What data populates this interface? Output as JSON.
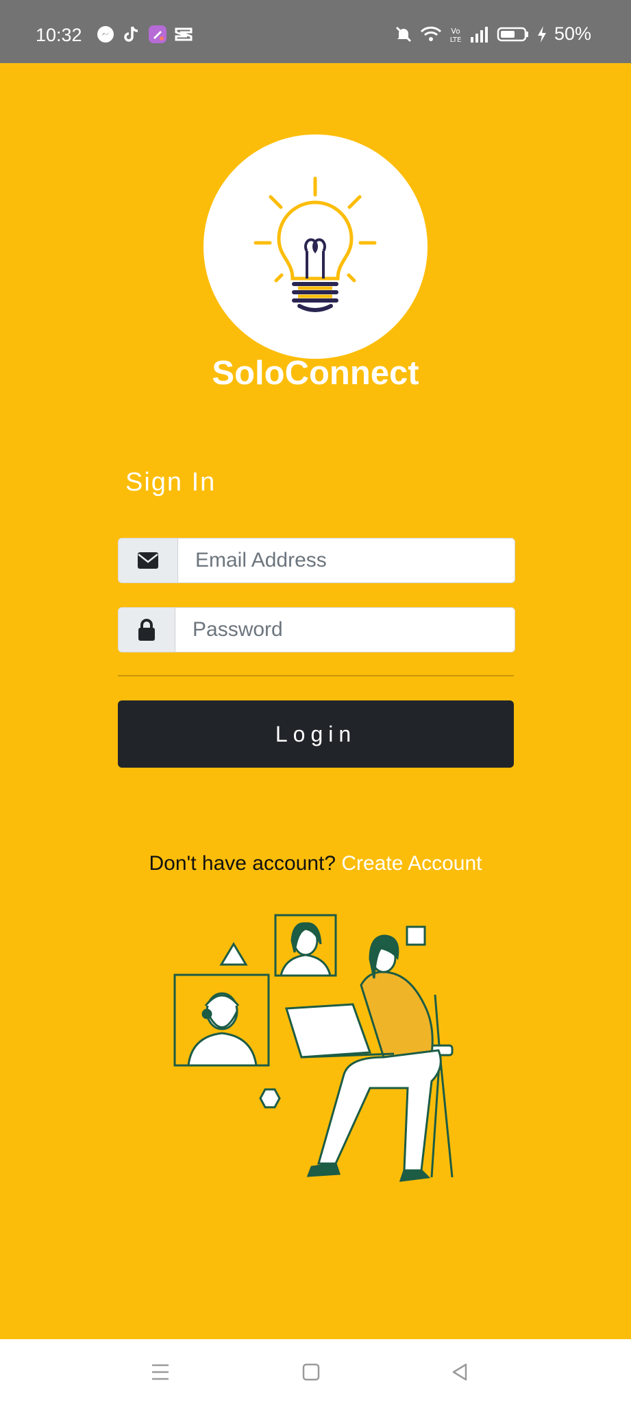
{
  "status_bar": {
    "time": "10:32",
    "notification_icons": [
      "messenger-icon",
      "tiktok-icon",
      "app-icon",
      "capcut-icon"
    ],
    "battery": "50%"
  },
  "app": {
    "title": "SoloConnect",
    "logo_icon": "lightbulb-icon"
  },
  "signin": {
    "heading": "Sign In",
    "email": {
      "placeholder": "Email Address",
      "value": "",
      "icon": "envelope-icon"
    },
    "password": {
      "placeholder": "Password",
      "value": "",
      "icon": "lock-icon"
    },
    "login_label": "Login"
  },
  "footer": {
    "question": "Don't have account?",
    "create_account": "Create Account"
  },
  "nav": {
    "items": [
      "menu-icon",
      "home-icon",
      "back-icon"
    ]
  },
  "colors": {
    "background": "#FCBD0A",
    "button": "#212529",
    "status_bar": "#737373"
  }
}
